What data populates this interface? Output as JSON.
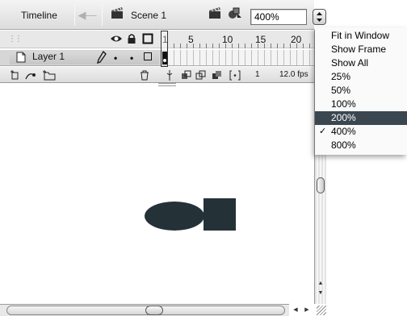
{
  "toolbar": {
    "timeline_label": "Timeline",
    "scene_label": "Scene 1",
    "zoom_value": "400%"
  },
  "timeline": {
    "frame_ruler": [
      "1",
      "5",
      "10",
      "15",
      "20"
    ],
    "layer_name": "Layer 1",
    "current_frame": "1",
    "frame_rate": "12.0 fps"
  },
  "zoom_menu": {
    "items": [
      "Fit in Window",
      "Show Frame",
      "Show All",
      "25%",
      "50%",
      "100%",
      "200%",
      "400%",
      "800%"
    ],
    "highlighted": "200%",
    "checked": "400%",
    "check_symbol": "✓"
  },
  "colors": {
    "shape_fill": "#243238",
    "menu_highlight": "#3a4750"
  }
}
